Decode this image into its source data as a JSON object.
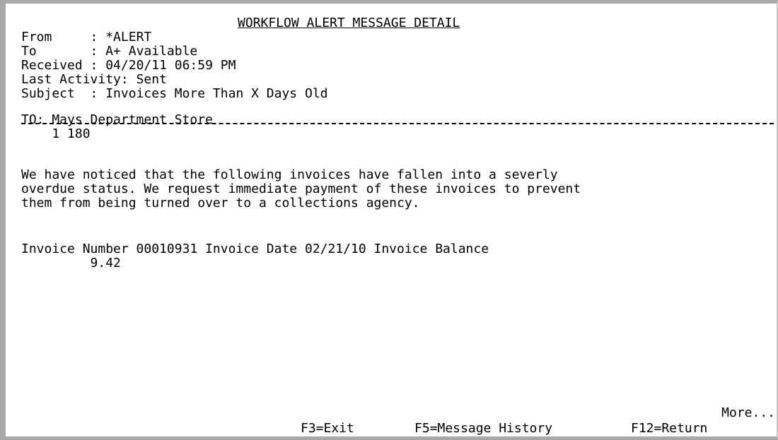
{
  "screen": {
    "title": "WORKFLOW ALERT MESSAGE DETAIL",
    "header": {
      "from_label": "From     :",
      "from_value": "*ALERT",
      "to_label": "To       :",
      "to_value": "A+ Available",
      "received_label": "Received :",
      "received_value": "04/20/11 06:59 PM",
      "last_activity_label": "Last Activity:",
      "last_activity_value": "Sent",
      "subject_label": "Subject  :",
      "subject_value": "Invoices More Than X Days Old"
    },
    "body": {
      "to_line": "TO: Mays Department Store",
      "account_line": "    1 180",
      "paragraph_1": "We have noticed that the following invoices have fallen into a severly",
      "paragraph_2": "overdue status. We request immediate payment of these invoices to prevent",
      "paragraph_3": "them from being turned over to a collections agency.",
      "invoice_line": "Invoice Number 00010931 Invoice Date 02/21/10 Invoice Balance",
      "balance_line": "         9.42"
    },
    "more_label": "More...",
    "function_keys": {
      "exit": "F3=Exit",
      "history": "F5=Message History",
      "return": "F12=Return"
    }
  }
}
